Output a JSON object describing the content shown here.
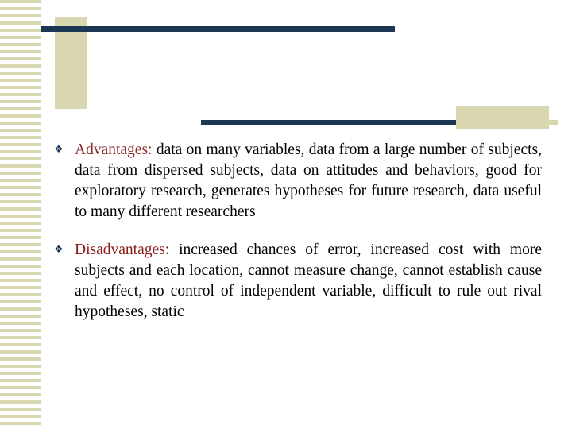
{
  "slide": {
    "decor": {
      "navy": "#1b3754",
      "khaki": "#d9d7b0",
      "label_color": "#8b1a1a"
    },
    "bullets": [
      {
        "marker": "❖",
        "label": "Advantages:",
        "text": " data on many variables, data from a large number of subjects, data from dispersed subjects, data on attitudes and behaviors, good for exploratory research, generates hypotheses for future research, data useful to many different researchers"
      },
      {
        "marker": "❖",
        "label": "Disadvantages:",
        "text": " increased chances of error, increased cost with more subjects and each location, cannot measure change, cannot establish cause and effect, no control of independent variable, difficult to rule out rival hypotheses, static"
      }
    ]
  }
}
